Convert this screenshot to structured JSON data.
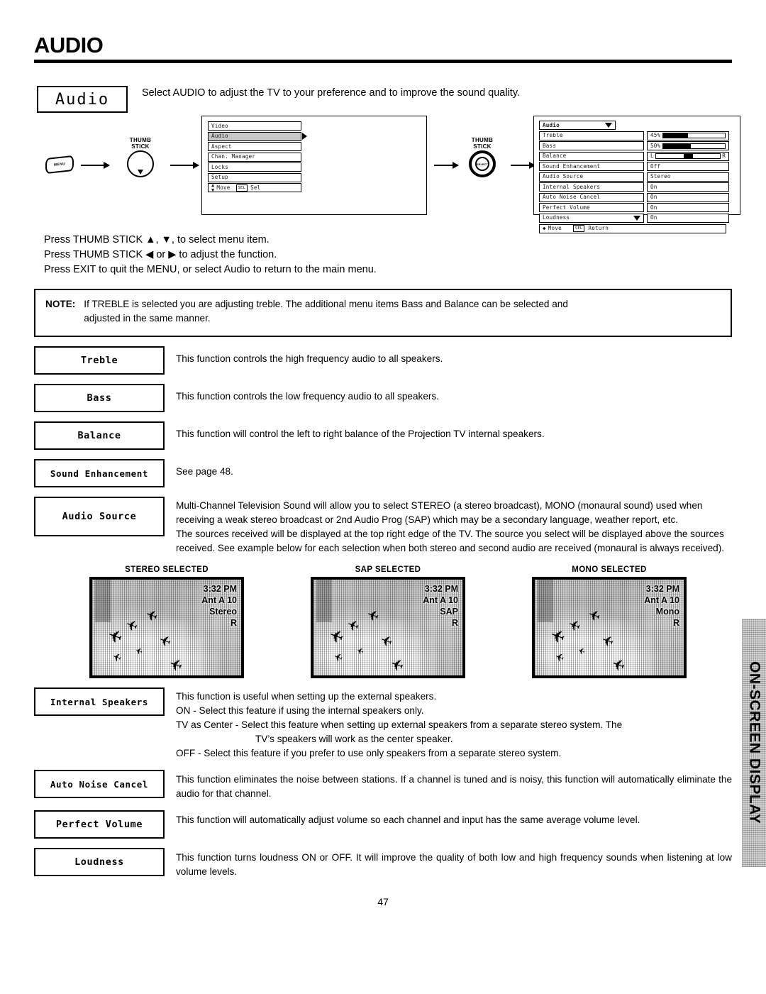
{
  "header": {
    "title": "AUDIO"
  },
  "intro": {
    "tag": "Audio",
    "description": "Select AUDIO to adjust the TV to your preference and to improve the sound quality."
  },
  "flow": {
    "menu_button_label": "MENU",
    "thumbstick_label_line1": "THUMB",
    "thumbstick_label_line2": "STICK",
    "thumbstick_inner_label": "SELECT"
  },
  "main_menu": {
    "items": [
      {
        "label": "Video",
        "highlighted": false
      },
      {
        "label": "Audio",
        "highlighted": true
      },
      {
        "label": "Aspect",
        "highlighted": false
      },
      {
        "label": "Chan. Manager",
        "highlighted": false
      },
      {
        "label": "Locks",
        "highlighted": false
      },
      {
        "label": "Setup",
        "highlighted": false
      }
    ],
    "footer_move": "Move",
    "footer_sel_chip": "SEL",
    "footer_sel": "Sel"
  },
  "audio_menu": {
    "title": "Audio",
    "rows": [
      {
        "label": "Treble",
        "value": "45%",
        "type": "bar",
        "percent": 45
      },
      {
        "label": "Bass",
        "value": "50%",
        "type": "bar",
        "percent": 50
      },
      {
        "label": "Balance",
        "value": "",
        "type": "balance",
        "left_mark": "L",
        "right_mark": "R",
        "position": 50
      },
      {
        "label": "Sound Enhancement",
        "value": "Off",
        "type": "text"
      },
      {
        "label": "Audio Source",
        "value": "Stereo",
        "type": "text"
      },
      {
        "label": "Internal Speakers",
        "value": "On",
        "type": "text"
      },
      {
        "label": "Auto Noise Cancel",
        "value": "On",
        "type": "text"
      },
      {
        "label": "Perfect Volume",
        "value": "On",
        "type": "text"
      },
      {
        "label": "Loudness",
        "value": "On",
        "type": "text",
        "caret": "down"
      }
    ],
    "footer_move": "Move",
    "footer_sel_chip": "SEL",
    "footer_return": "Return"
  },
  "instructions": [
    "Press THUMB STICK ▲, ▼, to select menu item.",
    "Press THUMB STICK ◀ or ▶ to adjust the function.",
    "Press EXIT to quit the MENU, or select Audio to return to the main menu."
  ],
  "note": {
    "label": "NOTE:",
    "line1": "If TREBLE is selected you are adjusting treble.  The additional menu items Bass and Balance can be selected and",
    "line2": "adjusted in the same manner."
  },
  "features": [
    {
      "name": "Treble",
      "text": "This function controls the high frequency audio to all speakers."
    },
    {
      "name": "Bass",
      "text": "This function controls the low frequency audio to all speakers."
    },
    {
      "name": "Balance",
      "text": "This function will control the left to right balance of the Projection TV internal speakers."
    },
    {
      "name": "Sound Enhancement",
      "text": "See page 48."
    },
    {
      "name": "Audio Source",
      "para1": "Multi-Channel Television Sound will allow you to select STEREO (a stereo broadcast), MONO (monaural sound) used when receiving a weak stereo broadcast or 2nd Audio Prog (SAP) which may be a secondary language, weather report, etc.",
      "para2": "The sources received will be displayed at the top right edge of the TV.  The source you select will be displayed above the sources received.  See example below for each selection when both stereo and second audio are received (monaural is always received)."
    },
    {
      "name": "Internal Speakers",
      "line1": "This function is useful when setting up the external speakers.",
      "line2": "ON - Select this feature if using the internal speakers only.",
      "line3": "TV as Center - Select this feature when setting up external speakers from a separate stereo system.  The",
      "line3b": "TV’s speakers will work as the center speaker.",
      "line4": "OFF - Select this feature if you prefer to use only speakers from a separate stereo system."
    },
    {
      "name": "Auto Noise Cancel",
      "text": "This function eliminates the noise between stations. If a channel is tuned and is noisy, this function will automatically eliminate the audio for that channel."
    },
    {
      "name": "Perfect Volume",
      "text": "This function will automatically adjust volume so each channel  and input has the same average volume level."
    },
    {
      "name": "Loudness",
      "text": "This function turns loudness ON or OFF.  It will improve the quality of both low and high frequency sounds when listening at low volume levels."
    }
  ],
  "tv_examples": [
    {
      "caption": "STEREO SELECTED",
      "time": "3:32 PM",
      "channel": "Ant A 10",
      "mode": "Stereo",
      "audio": "R"
    },
    {
      "caption": "SAP SELECTED",
      "time": "3:32 PM",
      "channel": "Ant A 10",
      "mode": "SAP",
      "audio": "R"
    },
    {
      "caption": "MONO SELECTED",
      "time": "3:32 PM",
      "channel": "Ant A 10",
      "mode": "Mono",
      "audio": "R"
    }
  ],
  "side_tab": {
    "label": "ON-SCREEN DISPLAY"
  },
  "page_number": "47"
}
